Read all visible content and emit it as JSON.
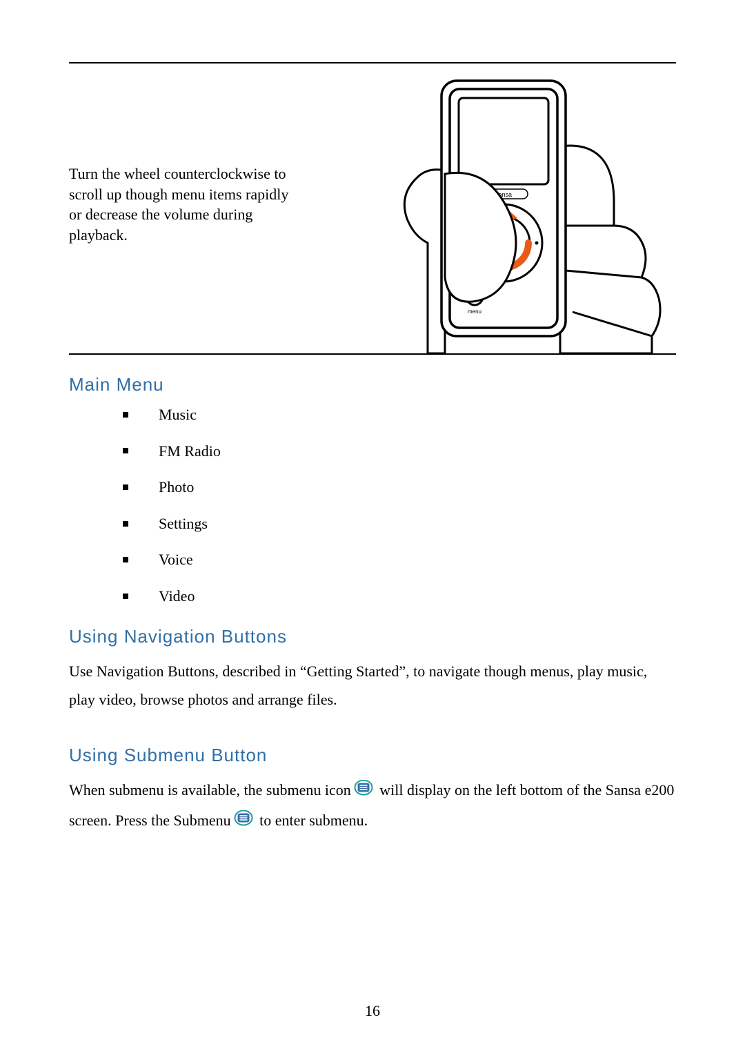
{
  "top": {
    "instruction": "Turn the wheel counterclockwise to scroll up though menu items rapidly or decrease the volume during playback.",
    "device_brand": "sansa",
    "wheel_labels": {
      "top": "",
      "left": "",
      "right": "",
      "bottom": ""
    }
  },
  "sections": {
    "main_menu": {
      "heading": "Main Menu",
      "items": [
        "Music",
        "FM Radio",
        "Photo",
        "Settings",
        "Voice",
        "Video"
      ]
    },
    "nav_buttons": {
      "heading": "Using Navigation Buttons",
      "para": "Use Navigation Buttons, described in “Getting Started”, to navigate though menus, play music, play video, browse photos and arrange files."
    },
    "submenu_button": {
      "heading": "Using Submenu Button",
      "run1": "When submenu is available, the submenu icon",
      "run2": " will display on the left bottom of the Sansa e200 screen. Press the Submenu",
      "run3": " to enter submenu."
    }
  },
  "icons": {
    "submenu": "submenu-icon"
  },
  "colors": {
    "heading": "#2F6FA7",
    "accent_orange": "#E85A1A",
    "icon_teal": "#1D9E9B",
    "icon_fill": "#3A6EA5"
  },
  "page_number": "16"
}
